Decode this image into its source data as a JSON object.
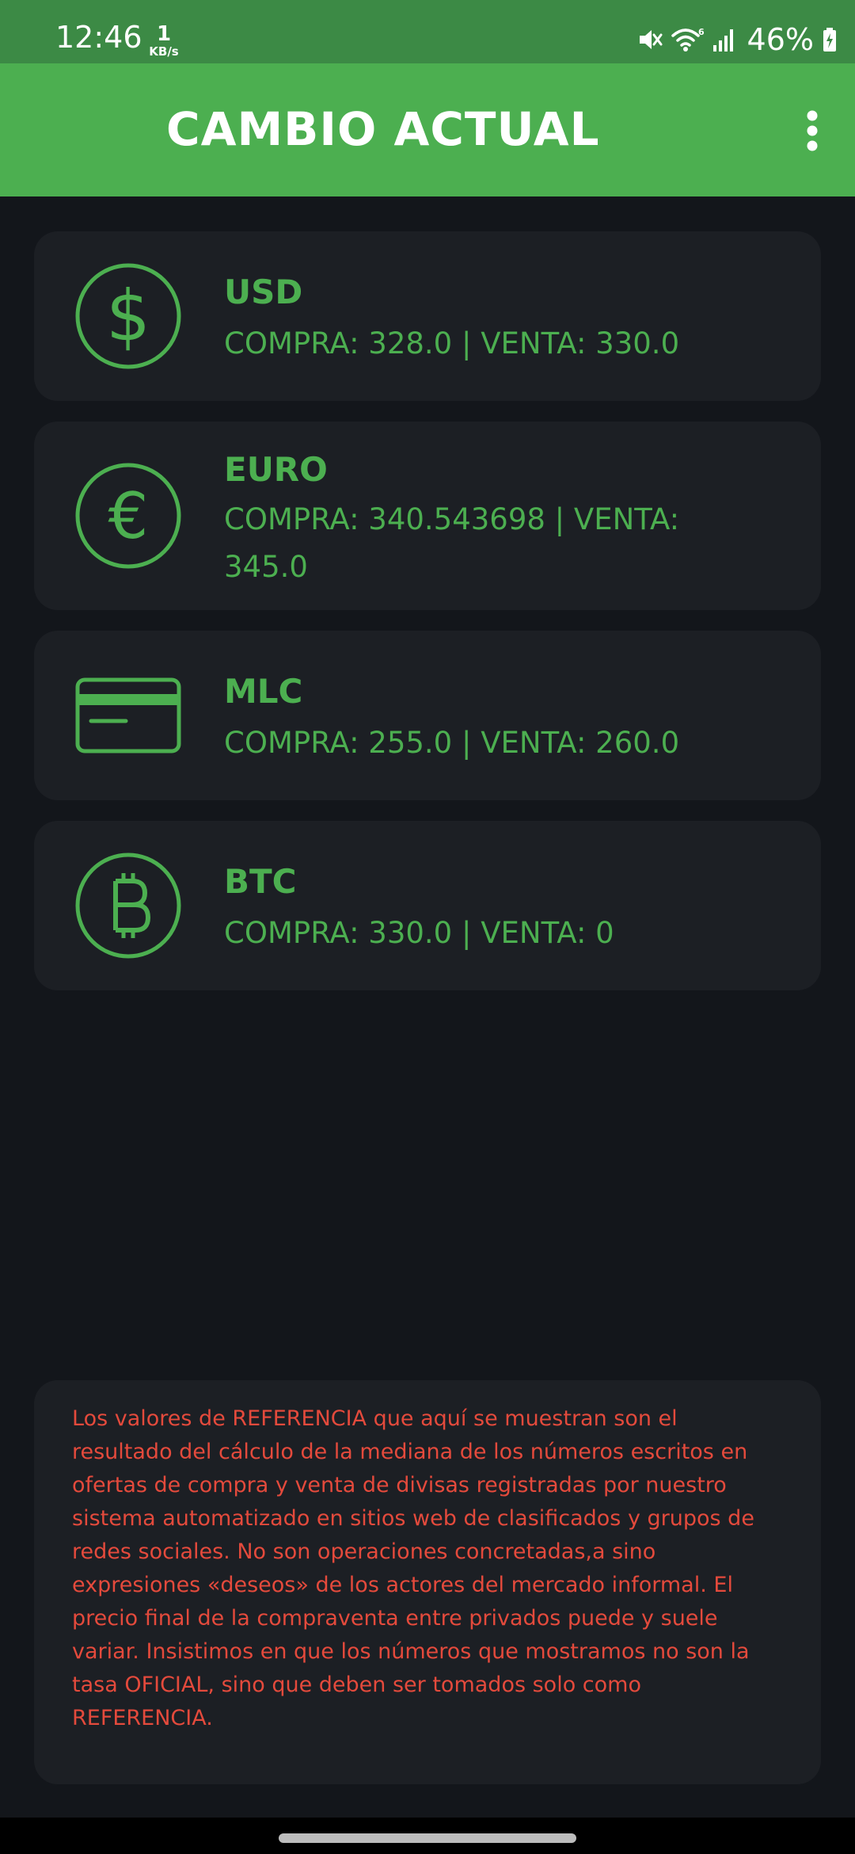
{
  "status_bar": {
    "time": "12:46",
    "net_speed_value": "1",
    "net_speed_unit": "KB/s",
    "battery": "46%",
    "icons": [
      "mute-icon",
      "wifi-icon",
      "signal-icon",
      "battery-charging-icon"
    ]
  },
  "app_bar": {
    "title": "CAMBIO ACTUAL",
    "menu_icon": "more-vertical-icon"
  },
  "currencies": [
    {
      "name": "USD",
      "rates": "COMPRA: 328.0 | VENTA: 330.0",
      "icon": "dollar-circle-icon"
    },
    {
      "name": "EURO",
      "rates": "COMPRA: 340.543698 | VENTA: 345.0",
      "icon": "euro-circle-icon"
    },
    {
      "name": "MLC",
      "rates": "COMPRA: 255.0 | VENTA: 260.0",
      "icon": "credit-card-icon"
    },
    {
      "name": "BTC",
      "rates": "COMPRA: 330.0 | VENTA: 0",
      "icon": "bitcoin-circle-icon"
    }
  ],
  "disclaimer": "Los valores de REFERENCIA que aquí se muestran son el resultado del cálculo de la mediana de los números escritos en ofertas de compra y venta de divisas registradas por nuestro sistema automatizado en sitios web de clasificados y grupos de redes sociales. No son operaciones concretadas,a sino expresiones «deseos» de los actores del mercado informal. El precio final de la compraventa entre privados puede y suele variar. Insistimos en que los números que mostramos no son la tasa OFICIAL, sino que deben ser tomados solo como REFERENCIA.",
  "colors": {
    "status_bar": "#3c8a45",
    "app_bar": "#4caf50",
    "background": "#13161b",
    "card": "#1c1f24",
    "accent_green": "#4caf50",
    "disclaimer_red": "#e44a3c"
  }
}
